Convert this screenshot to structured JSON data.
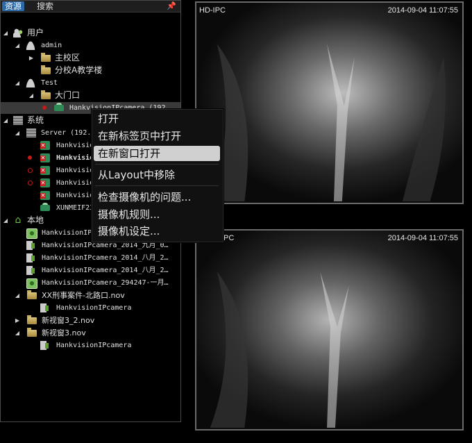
{
  "tabs": {
    "resources": "资源",
    "search": "搜索"
  },
  "tree": {
    "users": "用户",
    "admin": "admin",
    "main_campus": "主校区",
    "branch_teaching": "分校A教学楼",
    "test": "Test",
    "gate": "大门口",
    "gate_camera": "HankvisionIPcamera (192.…",
    "system": "系统",
    "server": "Server (192.…",
    "sys_cam1": "Hankvisio",
    "sys_cam2": "Hankvisio",
    "sys_cam3": "Hankvisio",
    "sys_cam4": "Hankvisio",
    "sys_cam5": "Hankvisio",
    "sys_cam6": "XUNMEIF23",
    "local": "本地",
    "local1": "HankvisionIP",
    "local2": "HankvisionIPcamera_2014_九月_0…",
    "local3": "HankvisionIPcamera_2014_八月_2…",
    "local4": "HankvisionIPcamera_2014_八月_2…",
    "local5": "HankvisionIPcamera_294247-一月…",
    "case_nov": "XX刑事案件-北路口.nov",
    "case_cam": "HankvisionIPcamera",
    "view32": "新视窗3_2.nov",
    "view3": "新视窗3.nov",
    "view3_cam": "HankvisionIPcamera"
  },
  "menu": {
    "open": "打开",
    "open_new_tab": "在新标签页中打开",
    "open_new_window": "在新窗口打开",
    "remove_layout": "从Layout中移除",
    "check_camera": "检查摄像机的问题...",
    "camera_rules": "摄像机规则...",
    "camera_settings": "摄像机设定..."
  },
  "video_top": {
    "label": "HD-IPC",
    "timestamp": "2014-09-04  11:07:55"
  },
  "video_bottom": {
    "label": "IPC",
    "timestamp": "2014-09-04  11:07:55"
  },
  "icons": {
    "pin": "pin-icon",
    "home": "home-icon"
  },
  "colors": {
    "accent": "#2f6aa8",
    "status_red": "#c41a1a",
    "menu_highlight": "#d0d0d0"
  }
}
